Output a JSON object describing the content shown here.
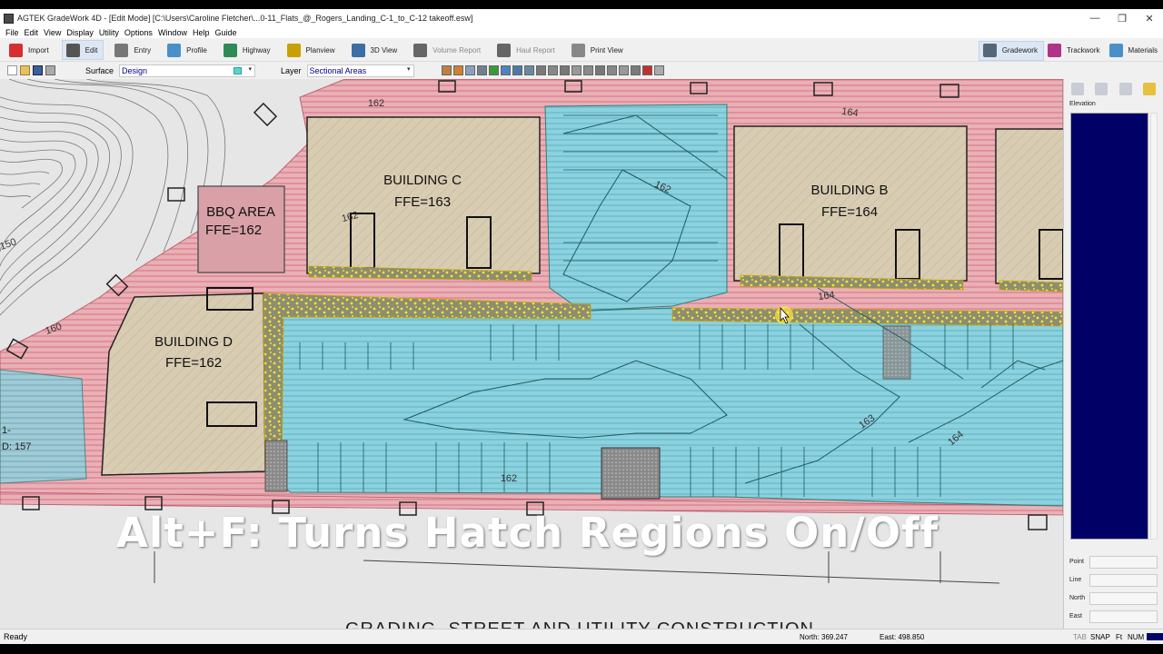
{
  "window": {
    "title": "AGTEK GradeWork 4D - [Edit Mode]  [C:\\Users\\Caroline Fletcher\\...0-11_Flats_@_Rogers_Landing_C-1_to_C-12 takeoff.esw]",
    "min": "—",
    "restore": "❐",
    "close": "✕"
  },
  "menu": [
    "File",
    "Edit",
    "View",
    "Display",
    "Utility",
    "Options",
    "Window",
    "Help",
    "Guide"
  ],
  "toolbar": {
    "modes": [
      {
        "label": "Import",
        "icon": "import-icon",
        "color": "#d62f2f",
        "active": false,
        "dim": false
      },
      {
        "label": "Edit",
        "icon": "edit-icon",
        "color": "#555555",
        "active": true,
        "dim": false
      },
      {
        "label": "Entry",
        "icon": "entry-icon",
        "color": "#777777",
        "active": false,
        "dim": false
      },
      {
        "label": "Profile",
        "icon": "profile-icon",
        "color": "#4a90c8",
        "active": false,
        "dim": false
      },
      {
        "label": "Highway",
        "icon": "highway-icon",
        "color": "#2e8b57",
        "active": false,
        "dim": false
      },
      {
        "label": "Planview",
        "icon": "planview-icon",
        "color": "#c8a000",
        "active": false,
        "dim": false
      },
      {
        "label": "3D View",
        "icon": "3d-view-icon",
        "color": "#3a6ea5",
        "active": false,
        "dim": false
      },
      {
        "label": "Volume Report",
        "icon": "volume-report-icon",
        "color": "#666666",
        "active": false,
        "dim": true
      },
      {
        "label": "Haul Report",
        "icon": "haul-report-icon",
        "color": "#666666",
        "active": false,
        "dim": true
      },
      {
        "label": "Print View",
        "icon": "print-view-icon",
        "color": "#888888",
        "active": false,
        "dim": false
      }
    ],
    "right": [
      {
        "label": "Gradework",
        "icon": "gradework-icon",
        "color": "#556677",
        "active": true
      },
      {
        "label": "Trackwork",
        "icon": "trackwork-icon",
        "color": "#b0338a",
        "active": false
      },
      {
        "label": "Materials",
        "icon": "materials-icon",
        "color": "#4a90c8",
        "active": false
      }
    ]
  },
  "surface": {
    "label": "Surface",
    "value": "Design"
  },
  "layer": {
    "label": "Layer",
    "value": "Sectional Areas"
  },
  "map": {
    "buildings": [
      {
        "name": "BUILDING C",
        "ffe": "FFE=163"
      },
      {
        "name": "BUILDING B",
        "ffe": "FFE=164"
      },
      {
        "name": "BBQ AREA",
        "ffe": "FFE=162"
      },
      {
        "name": "BUILDING D",
        "ffe": "FFE=162"
      }
    ],
    "contours": [
      "162",
      "164",
      "164",
      "162",
      "163",
      "164",
      "160",
      "150",
      "162",
      "162"
    ],
    "edge_labels": [
      "1-",
      "D: 157"
    ],
    "sheet_title": "GRADING, STREET AND UTILITY CONSTRUCTION"
  },
  "caption": "Alt+F: Turns Hatch Regions On/Off",
  "right_panel": {
    "elevation_label": "Elevation",
    "coords": [
      "Point",
      "Line",
      "North",
      "East"
    ]
  },
  "status": {
    "ready": "Ready",
    "north": "North: 369.247",
    "east": "East: 498.850",
    "indicators": [
      "TAB",
      "SNAP",
      "Ft",
      "NUM"
    ]
  },
  "colors": {
    "hatch_pink": "#e8a0a8",
    "hatch_blue": "#7ec8d8",
    "building_fill": "#d6ccb4",
    "walk_yellow": "#f0e040",
    "elev_panel": "#000066"
  }
}
